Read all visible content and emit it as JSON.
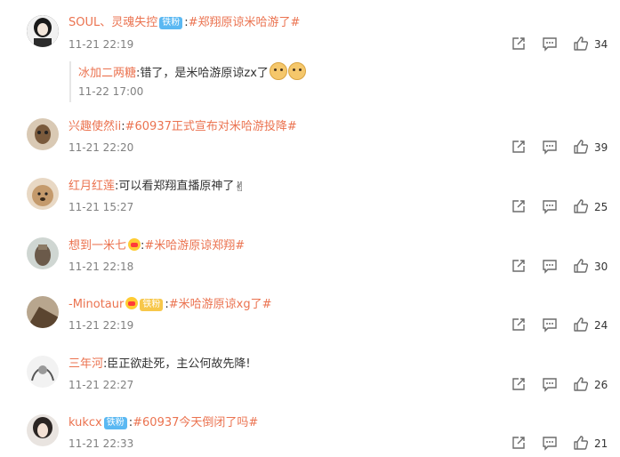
{
  "colors": {
    "username": "#eb7350",
    "topic": "#eb7350",
    "time": "#808080",
    "badge": "#5ab8f2"
  },
  "comments": [
    {
      "username": "SOUL、灵魂失控",
      "badge": "铁粉",
      "text": "#郑翔原谅米哈游了#",
      "time": "11-21 22:19",
      "likes": "34",
      "reply": {
        "username": "冰加二两糖",
        "text": "错了，是米哈游原谅zx了",
        "time": "11-22 17:00"
      }
    },
    {
      "username": "兴趣使然ii",
      "text": "#60937正式宣布对米哈游投降#",
      "time": "11-21 22:20",
      "likes": "39"
    },
    {
      "username": "红月红莲",
      "text": "可以看郑翔直播原神了",
      "time": "11-21 15:27",
      "likes": "25"
    },
    {
      "username": "想到一米七",
      "text": "#米哈游原谅郑翔#",
      "time": "11-21 22:18",
      "likes": "30"
    },
    {
      "username": "-Minotaur",
      "badge": "铁粉",
      "text": "#米哈游原谅xg了#",
      "time": "11-21 22:19",
      "likes": "24"
    },
    {
      "username": "三年河",
      "text": "臣正欲赴死，主公何故先降!",
      "time": "11-21 22:27",
      "likes": "26"
    },
    {
      "username": "kukcx",
      "badge": "铁粉",
      "text": "#60937今天倒闭了吗#",
      "time": "11-21 22:33",
      "likes": "21"
    }
  ]
}
